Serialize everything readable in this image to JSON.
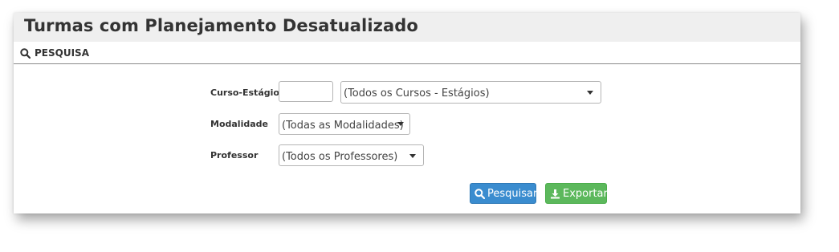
{
  "page": {
    "title": "Turmas com Planejamento Desatualizado"
  },
  "section": {
    "label": "PESQUISA",
    "icon": "search-icon"
  },
  "form": {
    "curso": {
      "label": "Curso-Estágio",
      "code_value": "",
      "selected": "(Todos os Cursos - Estágios)"
    },
    "modalidade": {
      "label": "Modalidade",
      "selected": "(Todas as Modalidades)"
    },
    "professor": {
      "label": "Professor",
      "selected": "(Todos os Professores)"
    }
  },
  "buttons": {
    "search": {
      "label": "Pesquisar",
      "icon": "search-icon",
      "color": "#3a8ccf"
    },
    "export": {
      "label": "Exportar",
      "icon": "download-icon",
      "color": "#5cb85c"
    }
  }
}
